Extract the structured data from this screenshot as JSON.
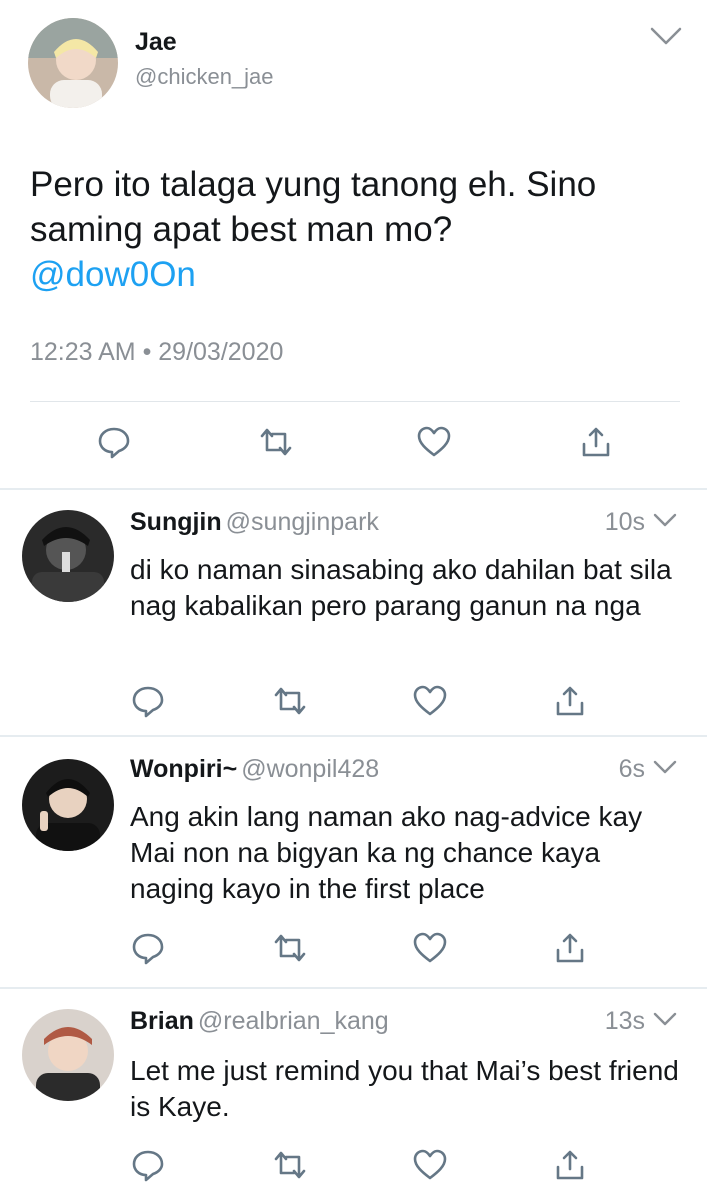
{
  "main_tweet": {
    "name": "Jae",
    "handle": "@chicken_jae",
    "text": "Pero ito talaga yung tanong eh. Sino saming apat best man mo?",
    "mention": "@dow0On",
    "timestamp": "12:23 AM • 29/03/2020",
    "icons": [
      "reply-icon",
      "retweet-icon",
      "like-icon",
      "share-icon",
      "chevron-down-icon"
    ]
  },
  "replies": [
    {
      "name": "Sungjin",
      "handle": "@sungjinpark",
      "time": "10s",
      "text": "di ko naman sinasabing ako dahilan bat sila nag kabalikan pero parang ganun na nga"
    },
    {
      "name": "Wonpiri~",
      "handle": "@wonpil428",
      "time": "6s",
      "text": "Ang akin lang naman ako nag-advice kay Mai non na bigyan ka ng chance kaya naging kayo in the first place"
    },
    {
      "name": "Brian",
      "handle": "@realbrian_kang",
      "time": "13s",
      "text": "Let me just remind you that Mai’s best friend is Kaye."
    }
  ],
  "colors": {
    "text": "#14171a",
    "secondary": "#8a8f95",
    "link": "#1da1f2",
    "icon": "#657786",
    "divider": "#e6ecf0"
  }
}
